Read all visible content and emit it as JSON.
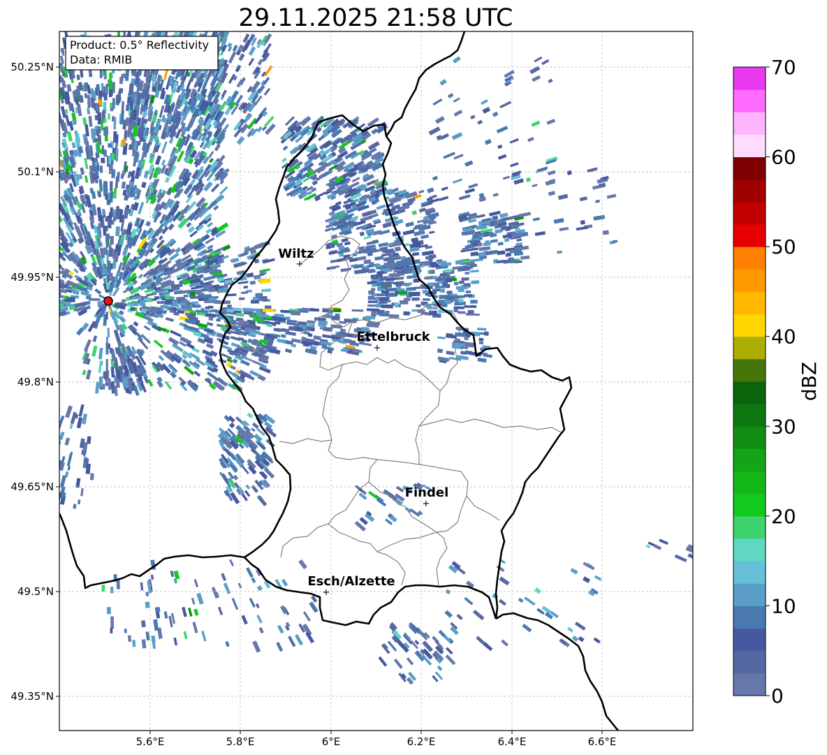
{
  "title": "29.11.2025 21:58 UTC",
  "info_box": {
    "product": "Product: 0.5° Reflectivity",
    "source": "Data: RMIB"
  },
  "axes": {
    "lon_ticks": [
      "5.6°E",
      "5.8°E",
      "6°E",
      "6.2°E",
      "6.4°E",
      "6.6°E"
    ],
    "lat_ticks": [
      "50.25°N",
      "50.1°N",
      "49.95°N",
      "49.8°N",
      "49.65°N",
      "49.5°N",
      "49.35°N"
    ],
    "grid": true
  },
  "colorbar": {
    "label": "dBZ",
    "ticks": [
      "0",
      "10",
      "20",
      "30",
      "40",
      "50",
      "60",
      "70"
    ],
    "range": [
      0,
      70
    ],
    "colors": [
      "#6678aa",
      "#5668a2",
      "#46599e",
      "#4a79b0",
      "#5a9ec8",
      "#66c0d8",
      "#5fd7c3",
      "#3fd36f",
      "#13c91b",
      "#13b818",
      "#13a516",
      "#108e14",
      "#0e7810",
      "#0a640c",
      "#46760a",
      "#acae05",
      "#ffd700",
      "#ffb700",
      "#ff9900",
      "#ff7f00",
      "#e60000",
      "#c20000",
      "#a00000",
      "#7f0000",
      "#ffdcff",
      "#ffb4ff",
      "#ff6cff",
      "#e838f0"
    ]
  },
  "cities": [
    {
      "name": "Wiltz"
    },
    {
      "name": "Ettelbruck"
    },
    {
      "name": "Findel"
    },
    {
      "name": "Esch/Alzette"
    }
  ],
  "legend_note": "",
  "map_layers": {
    "radar_color_scheme": "reflectivity dBZ",
    "radar_site_marker_color": "#ee1111"
  }
}
